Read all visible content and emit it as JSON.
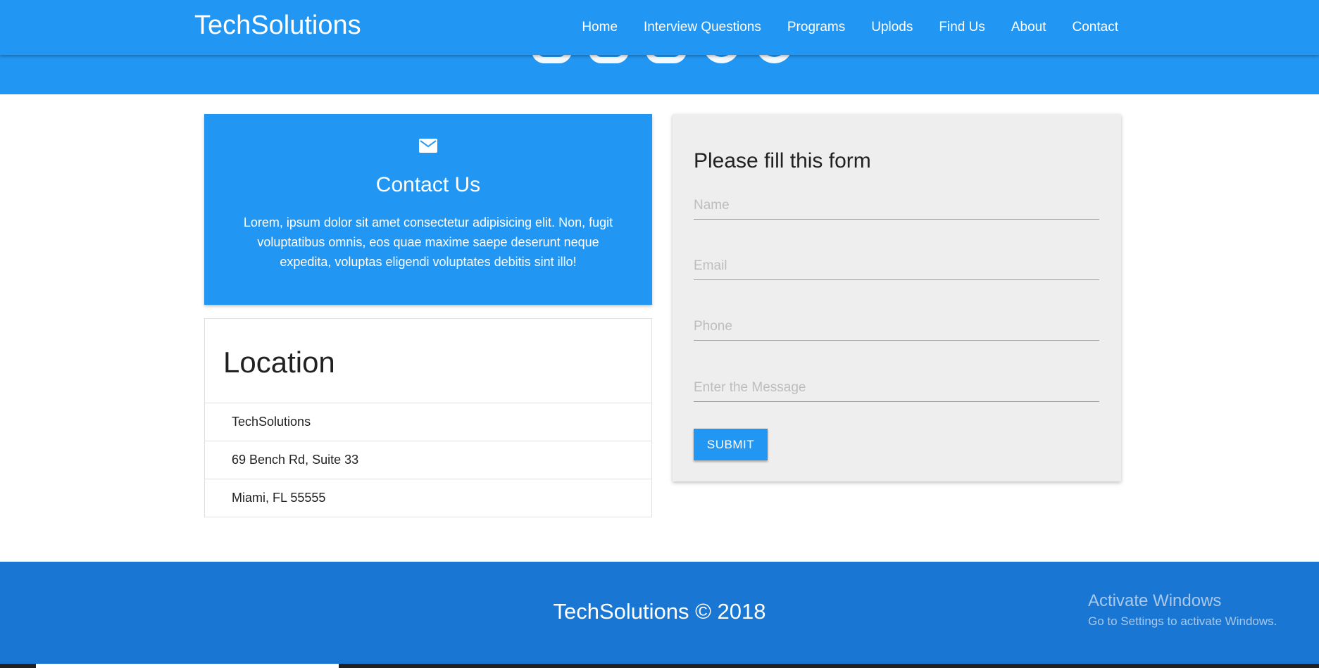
{
  "navbar": {
    "brand": "TechSolutions",
    "links": [
      "Home",
      "Interview Questions",
      "Programs",
      "Uplods",
      "Find Us",
      "About",
      "Contact"
    ]
  },
  "hero": {
    "icons": [
      "social-icon-1",
      "social-icon-2",
      "social-icon-3",
      "social-icon-4",
      "social-icon-5"
    ]
  },
  "contact_card": {
    "icon": "mail-icon",
    "title": "Contact Us",
    "text": "Lorem, ipsum dolor sit amet consectetur adipisicing elit. Non, fugit voluptatibus omnis, eos quae maxime saepe deserunt neque expedita, voluptas eligendi voluptates debitis sint illo!"
  },
  "location": {
    "title": "Location",
    "items": [
      "TechSolutions",
      "69 Bench Rd, Suite 33",
      "Miami, FL 55555"
    ]
  },
  "form": {
    "title": "Please fill this form",
    "name_placeholder": "Name",
    "email_placeholder": "Email",
    "phone_placeholder": "Phone",
    "message_placeholder": "Enter the Message",
    "submit_label": "SUBMIT"
  },
  "footer": {
    "text": "TechSolutions © 2018"
  },
  "watermark": {
    "title": "Activate Windows",
    "subtitle": "Go to Settings to activate Windows."
  },
  "colors": {
    "primary": "#2196f3",
    "footer": "#1976d2",
    "form_bg": "#eeeeee"
  }
}
